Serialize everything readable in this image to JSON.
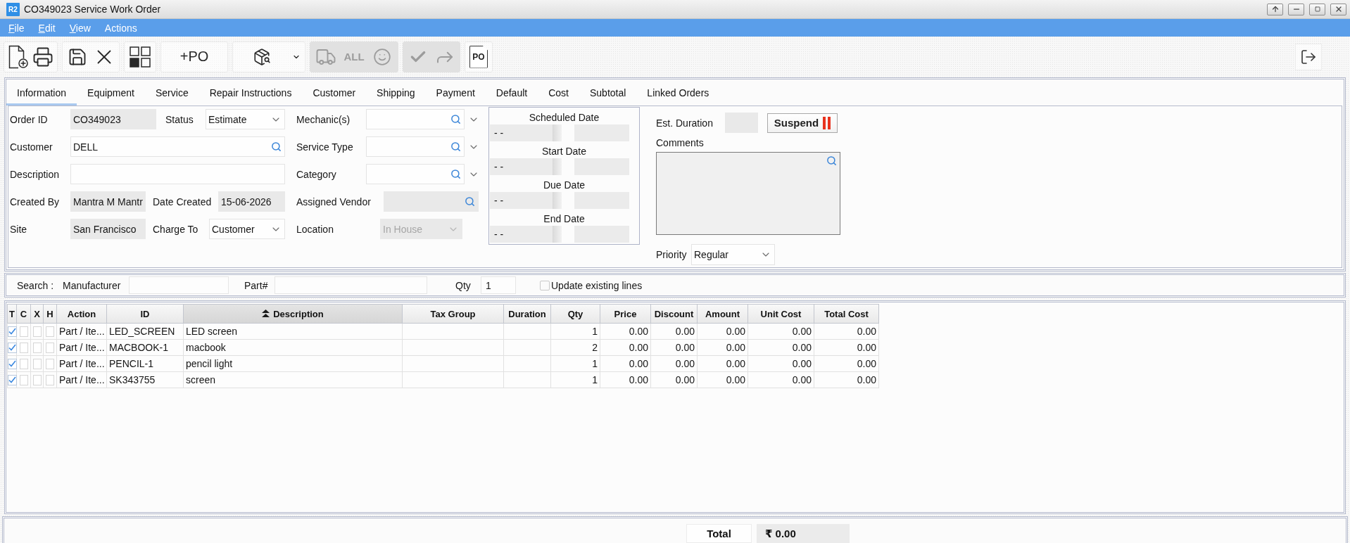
{
  "window": {
    "logo": "R2",
    "title": "CO349023 Service Work Order",
    "controls": [
      {
        "kind": "up"
      },
      {
        "kind": "minimize"
      },
      {
        "kind": "restore"
      },
      {
        "kind": "close"
      }
    ]
  },
  "menu": [
    {
      "label": "File",
      "mnemonic": true
    },
    {
      "label": "Edit",
      "mnemonic": true
    },
    {
      "label": "View",
      "mnemonic": true
    },
    {
      "label": "Actions",
      "mnemonic": false
    }
  ],
  "toolbar": {
    "groups": [
      {
        "disabled": false,
        "items": [
          {
            "kind": "new"
          },
          {
            "kind": "print"
          }
        ]
      },
      {
        "disabled": false,
        "items": [
          {
            "kind": "save"
          },
          {
            "kind": "close"
          }
        ]
      },
      {
        "disabled": false,
        "items": [
          {
            "kind": "grid"
          }
        ]
      },
      {
        "disabled": false,
        "items": [
          {
            "kind": "text",
            "label": "+PO"
          }
        ]
      },
      {
        "disabled": false,
        "items": [
          {
            "kind": "package-search"
          },
          {
            "kind": "caret"
          }
        ]
      },
      {
        "disabled": true,
        "items": [
          {
            "kind": "truck"
          },
          {
            "kind": "text",
            "label": "ALL"
          },
          {
            "kind": "smile"
          }
        ]
      },
      {
        "disabled": true,
        "items": [
          {
            "kind": "check"
          },
          {
            "kind": "forward"
          }
        ]
      },
      {
        "disabled": false,
        "items": [
          {
            "kind": "document",
            "label": "PO"
          }
        ]
      }
    ],
    "end": [
      {
        "kind": "exit"
      }
    ]
  },
  "tabs": [
    {
      "label": "Information",
      "selected": true
    },
    {
      "label": "Equipment",
      "selected": false
    },
    {
      "label": "Service",
      "selected": false
    },
    {
      "label": "Repair Instructions",
      "selected": false
    },
    {
      "label": "Customer",
      "selected": false
    },
    {
      "label": "Shipping",
      "selected": false
    },
    {
      "label": "Payment",
      "selected": false
    },
    {
      "label": "Default",
      "selected": false
    },
    {
      "label": "Cost",
      "selected": false
    },
    {
      "label": "Subtotal",
      "selected": false
    },
    {
      "label": "Linked Orders",
      "selected": false
    }
  ],
  "form": {
    "left_rows": [
      {
        "fields": [
          {
            "label": "Order ID",
            "kind": "readonly",
            "value": "CO349023",
            "disabled": false
          },
          {
            "label": "Status",
            "kind": "dropdown",
            "value": "Estimate",
            "disabled": false
          }
        ]
      },
      {
        "fields": [
          {
            "label": "Customer",
            "kind": "lookup",
            "value": "DELL",
            "disabled": false
          }
        ]
      },
      {
        "fields": [
          {
            "label": "Description",
            "kind": "text",
            "disabled": false
          }
        ]
      },
      {
        "fields": [
          {
            "label": "Created By",
            "kind": "readonly",
            "value": "Mantra M Mantr",
            "disabled": false
          },
          {
            "label": "Date Created",
            "kind": "readonly",
            "value": "15-06-2026",
            "disabled": false
          }
        ]
      },
      {
        "fields": [
          {
            "label": "Site",
            "kind": "readonly",
            "value": "San Francisco",
            "disabled": false
          },
          {
            "label": "Charge To",
            "kind": "dropdown",
            "value": "Customer",
            "disabled": false
          }
        ]
      }
    ],
    "middle_rows": [
      {
        "label": "Mechanic(s)",
        "kind": "lookup-dropdown",
        "disabled": false
      },
      {
        "label": "Service Type",
        "kind": "lookup-dropdown",
        "disabled": false
      },
      {
        "label": "Category",
        "kind": "lookup-dropdown",
        "disabled": false
      },
      {
        "label": "Assigned Vendor",
        "kind": "lookup",
        "disabled": true
      },
      {
        "label": "Location",
        "kind": "dropdown",
        "value": "In House",
        "disabled": true
      }
    ],
    "dates": [
      {
        "label": "Scheduled Date",
        "date": "- -"
      },
      {
        "label": "Start Date",
        "date": "- -"
      },
      {
        "label": "Due Date",
        "date": "- -"
      },
      {
        "label": "End Date",
        "date": "- -"
      }
    ],
    "est_duration": {
      "label": "Est. Duration"
    },
    "suspend_button": {
      "label": "Suspend"
    },
    "comments": {
      "label": "Comments"
    },
    "priority": {
      "label": "Priority",
      "value": "Regular"
    }
  },
  "search": {
    "label": "Search :",
    "fields": [
      {
        "label": "Manufacturer"
      },
      {
        "label": "Part#"
      },
      {
        "label": "Qty",
        "value": "1"
      }
    ],
    "update_lines": {
      "label": "Update existing lines",
      "checked": false
    }
  },
  "table": {
    "flag_columns": [
      {
        "label": "T"
      },
      {
        "label": "C"
      },
      {
        "label": "X"
      },
      {
        "label": "H"
      }
    ],
    "columns": [
      {
        "label": "Action",
        "kind": "text",
        "sorted": false
      },
      {
        "label": "ID",
        "kind": "text",
        "sorted": false
      },
      {
        "label": "Description",
        "kind": "text",
        "sorted": true
      },
      {
        "label": "Tax Group",
        "kind": "text",
        "sorted": false
      },
      {
        "label": "Duration",
        "kind": "text",
        "sorted": false
      },
      {
        "label": "Qty",
        "kind": "number",
        "sorted": false
      },
      {
        "label": "Price",
        "kind": "number",
        "sorted": false
      },
      {
        "label": "Discount",
        "kind": "number",
        "sorted": false
      },
      {
        "label": "Amount",
        "kind": "number",
        "sorted": false
      },
      {
        "label": "Unit Cost",
        "kind": "number",
        "sorted": false
      },
      {
        "label": "Total Cost",
        "kind": "number",
        "sorted": false
      }
    ],
    "rows": [
      {
        "flags": [
          true,
          false,
          false,
          false
        ],
        "cells": [
          "Part / Ite...",
          "LED_SCREEN",
          "LED screen",
          null,
          null,
          "1",
          "0.00",
          "0.00",
          "0.00",
          "0.00",
          "0.00"
        ]
      },
      {
        "flags": [
          true,
          false,
          false,
          false
        ],
        "cells": [
          "Part / Ite...",
          "MACBOOK-1",
          "macbook",
          null,
          null,
          "2",
          "0.00",
          "0.00",
          "0.00",
          "0.00",
          "0.00"
        ]
      },
      {
        "flags": [
          true,
          false,
          false,
          false
        ],
        "cells": [
          "Part / Ite...",
          "PENCIL-1",
          "pencil light",
          null,
          null,
          "1",
          "0.00",
          "0.00",
          "0.00",
          "0.00",
          "0.00"
        ]
      },
      {
        "flags": [
          true,
          false,
          false,
          false
        ],
        "cells": [
          "Part / Ite...",
          "SK343755",
          "screen",
          null,
          null,
          "1",
          "0.00",
          "0.00",
          "0.00",
          "0.00",
          "0.00"
        ]
      }
    ]
  },
  "footer": {
    "total_label": "Total",
    "total_value": "₹ 0.00"
  }
}
